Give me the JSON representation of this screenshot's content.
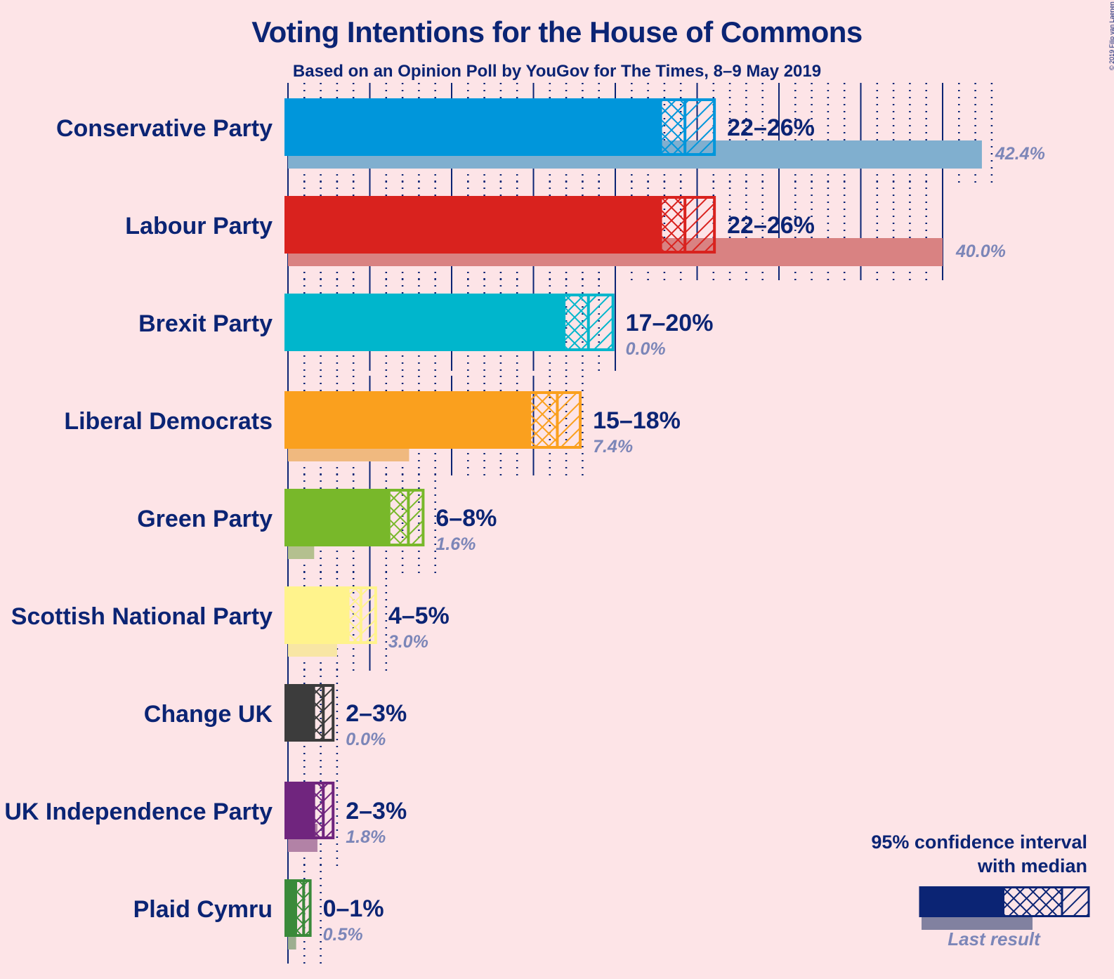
{
  "title": "Voting Intentions for the House of Commons",
  "subtitle": "Based on an Opinion Poll by YouGov for The Times, 8–9 May 2019",
  "copyright": "© 2019 Filip van Laenen",
  "legend": {
    "title_line1": "95% confidence interval",
    "title_line2": "with median",
    "last_result": "Last result",
    "color": "#0b2474",
    "last_color": "#8181a0"
  },
  "chart_data": {
    "type": "bar",
    "title": "Voting Intentions for the House of Commons",
    "subtitle": "Based on an Opinion Poll by YouGov for The Times, 8–9 May 2019",
    "xlabel": "",
    "ylabel": "",
    "unit": "%",
    "xlim": [
      0,
      43
    ],
    "grid": {
      "major_step": 5,
      "minor_step": 1
    },
    "legend_position": "bottom-right",
    "categories": [
      "Conservative Party",
      "Labour Party",
      "Brexit Party",
      "Liberal Democrats",
      "Green Party",
      "Scottish National Party",
      "Change UK",
      "UK Independence Party",
      "Plaid Cymru"
    ],
    "series": [
      {
        "name": "95% CI lower",
        "values": [
          22.9,
          22.9,
          17.0,
          14.9,
          6.3,
          3.8,
          1.7,
          1.7,
          0.6
        ]
      },
      {
        "name": "Median",
        "values": [
          24.3,
          24.3,
          18.4,
          16.5,
          7.4,
          4.5,
          2.2,
          2.2,
          1.0
        ]
      },
      {
        "name": "95% CI upper",
        "values": [
          26.1,
          26.1,
          19.9,
          17.9,
          8.3,
          5.4,
          2.8,
          2.8,
          1.4
        ]
      },
      {
        "name": "Last result",
        "values": [
          42.4,
          40.0,
          0.0,
          7.4,
          1.6,
          3.0,
          0.0,
          1.8,
          0.5
        ]
      }
    ],
    "range_labels": [
      "22–26%",
      "22–26%",
      "17–20%",
      "15–18%",
      "6–8%",
      "4–5%",
      "2–3%",
      "2–3%",
      "0–1%"
    ],
    "last_labels": [
      "42.4%",
      "40.0%",
      "0.0%",
      "7.4%",
      "1.6%",
      "3.0%",
      "0.0%",
      "1.8%",
      "0.5%"
    ],
    "colors": [
      "#0096db",
      "#d9221e",
      "#00b6cc",
      "#faa01e",
      "#78b82a",
      "#fff38c",
      "#3c3c3c",
      "#70257e",
      "#3a8a3a"
    ],
    "last_colors": [
      "#80afcf",
      "#d98282",
      "#80cfd8",
      "#f0b97f",
      "#b4c08f",
      "#f8e6a4",
      "#8e8e8e",
      "#b282a6",
      "#9cae90"
    ]
  }
}
